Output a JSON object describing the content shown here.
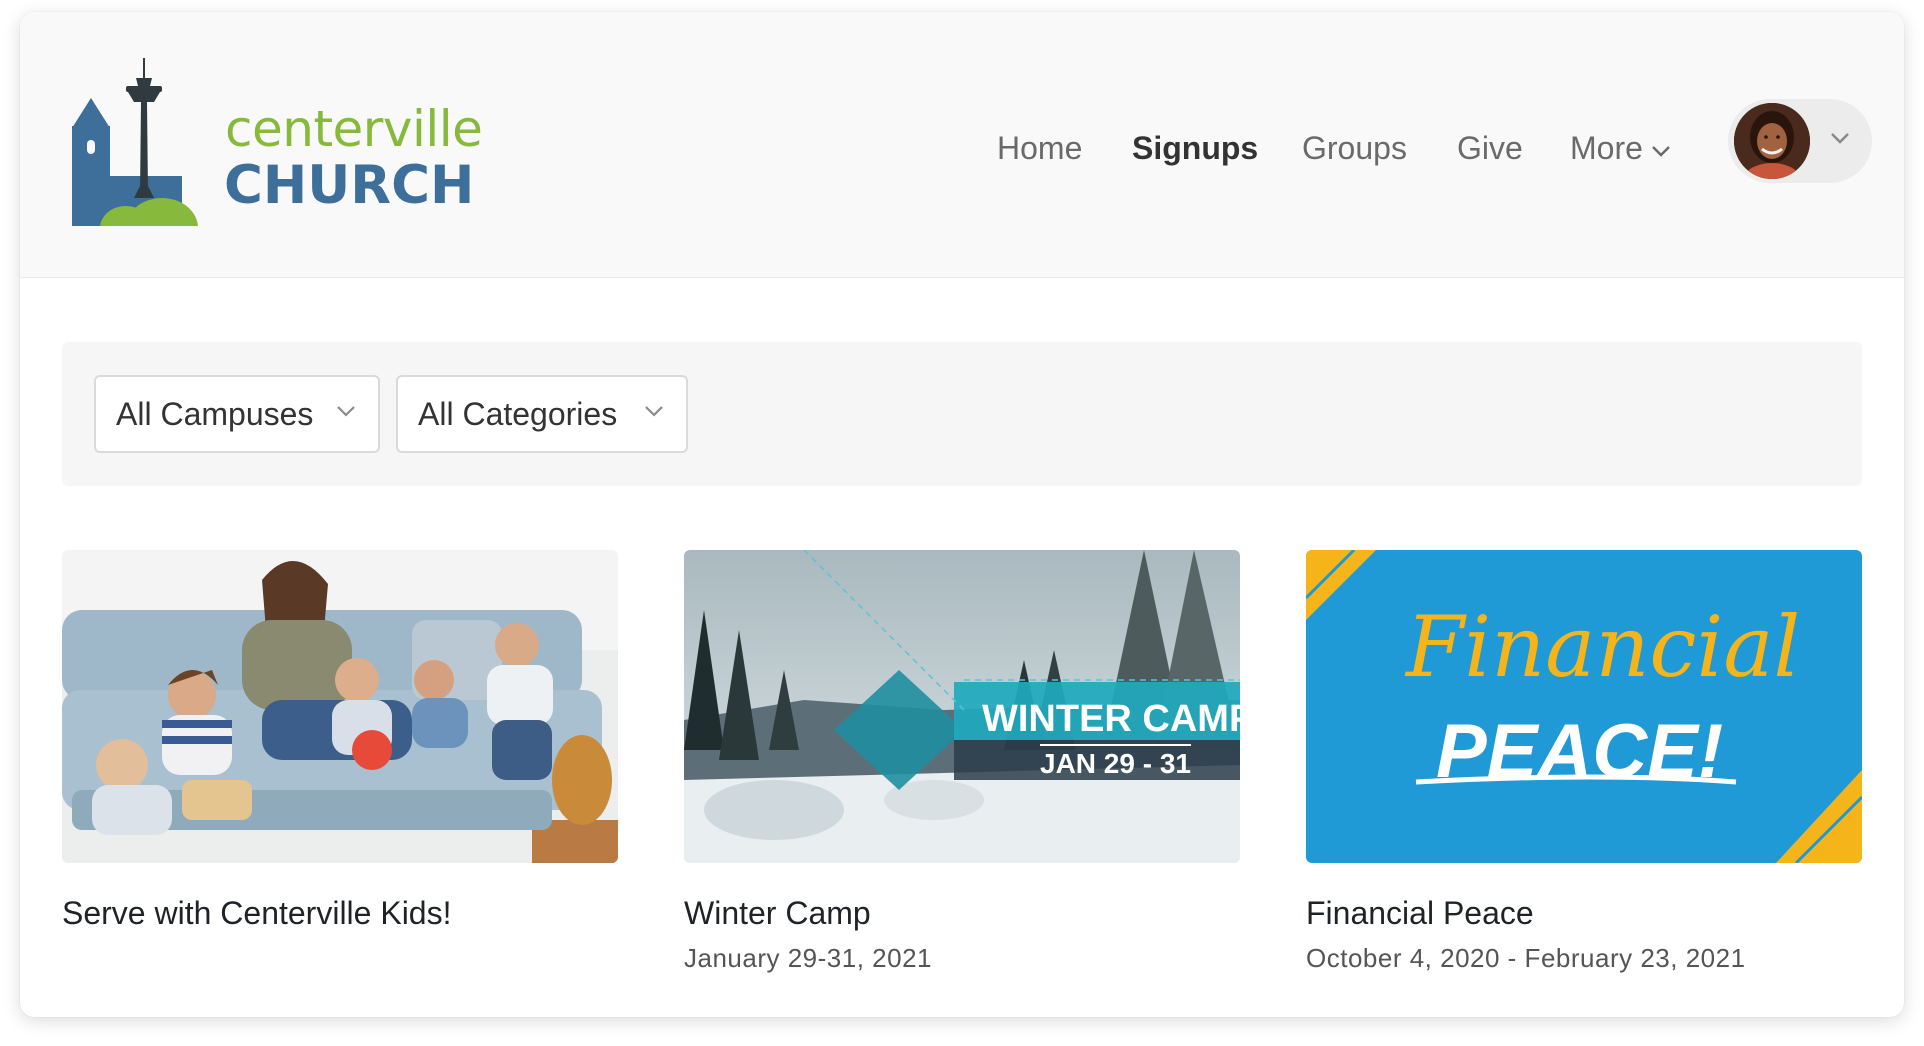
{
  "header": {
    "logo": {
      "line1": "centerville",
      "line2": "CHURCH"
    },
    "nav": [
      {
        "label": "Home",
        "active": false
      },
      {
        "label": "Signups",
        "active": true
      },
      {
        "label": "Groups",
        "active": false
      },
      {
        "label": "Give",
        "active": false
      },
      {
        "label": "More",
        "active": false,
        "icon": "chevron-down-icon"
      }
    ],
    "user_menu": {
      "avatar": "user-avatar",
      "icon": "chevron-down-icon"
    }
  },
  "filters": {
    "campus": {
      "selected": "All Campuses",
      "icon": "chevron-down-icon"
    },
    "category": {
      "selected": "All Categories",
      "icon": "chevron-down-icon"
    }
  },
  "cards": [
    {
      "title": "Serve with Centerville Kids!",
      "date": "",
      "image": "family-on-couch-photo"
    },
    {
      "title": "Winter Camp",
      "date": "January 29-31, 2021",
      "image": "winter-camp-banner",
      "image_text": {
        "line1": "WINTER CAMP",
        "line2": "JAN 29 - 31"
      }
    },
    {
      "title": "Financial Peace",
      "date": "October 4, 2020 - February 23, 2021",
      "image": "financial-peace-banner",
      "image_text": {
        "line1": "Financial",
        "line2": "PEACE!"
      }
    }
  ],
  "colors": {
    "logo_green": "#86b93c",
    "logo_blue": "#3e6f9b",
    "financial_blue": "#1f9ad6",
    "financial_yellow": "#f4b41a"
  }
}
